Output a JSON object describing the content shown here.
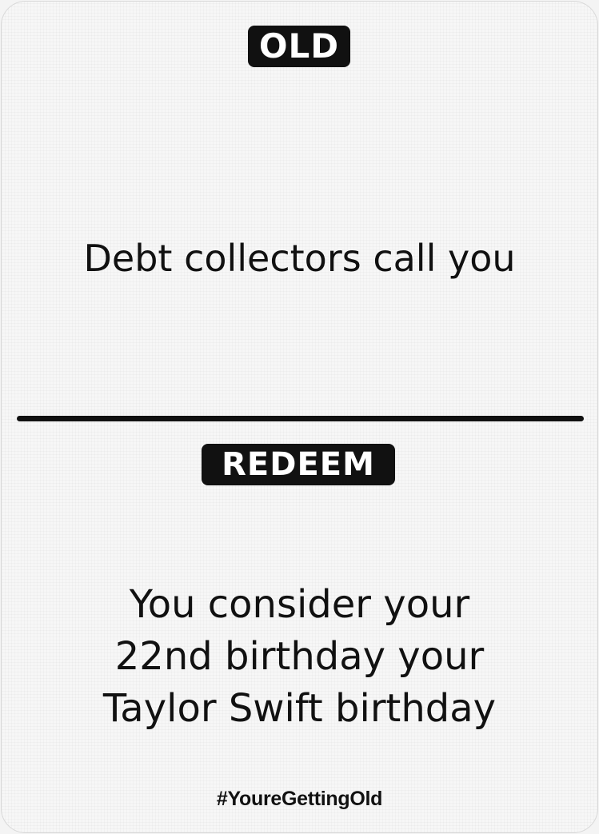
{
  "card": {
    "top_badge": "OLD",
    "prompt": "Debt collectors call you",
    "bottom_badge": "REDEEM",
    "redeem_lines": [
      "You consider your",
      "22nd birthday your",
      "Taylor Swift birthday"
    ],
    "hashtag": "#YoureGettingOld"
  },
  "colors": {
    "ink": "#111111",
    "card_background": "#f7f7f7"
  }
}
